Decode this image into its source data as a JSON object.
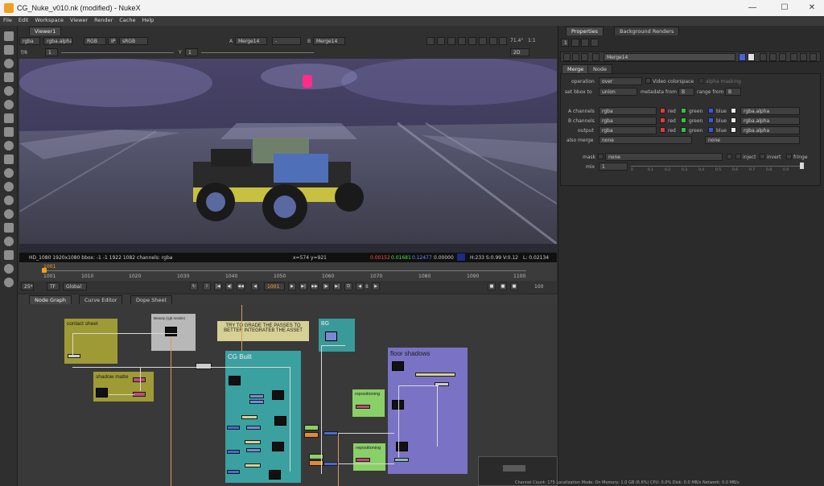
{
  "window": {
    "title": "CG_Nuke_v010.nk (modified) - NukeX"
  },
  "menu": [
    "File",
    "Edit",
    "Workspace",
    "Viewer",
    "Render",
    "Cache",
    "Help"
  ],
  "viewer": {
    "tab": "Viewer1",
    "channels": "rgba",
    "alpha": "rgba.alpha",
    "colorspace_mode": "RGB",
    "ip": "IP",
    "lut": "sRGB",
    "input_a_label": "A",
    "input_a": "Merge14",
    "input_sep": "-",
    "input_b_label": "B",
    "input_b": "Merge14",
    "zoom": "71.4°",
    "ratio": "1:1",
    "fstop": "f/8",
    "frame_field": "1",
    "y_label": "Y",
    "y_value": "1",
    "view_mode": "2D"
  },
  "infobar": {
    "format": "HD_1080 1920x1080  bbox: -1 -1 1922 1082 channels: rgba",
    "coords": "x=574 y=921",
    "r": "0.00152",
    "g": "0.01681",
    "b": "0.12477",
    "a": "0.00000",
    "hsv": "H:233 S:0.99 V:0.12",
    "l": "L: 0.02134"
  },
  "timeline": {
    "current_frame_marker": "1001",
    "ticks": [
      "1001",
      "1010",
      "1020",
      "1030",
      "1040",
      "1050",
      "1060",
      "1070",
      "1080",
      "1090",
      "1100"
    ],
    "fps": "25*",
    "tf": "TF",
    "scope": "Global",
    "frame": "1001",
    "step": "8",
    "end": "100"
  },
  "nodegraph": {
    "tabs": [
      "Node Graph",
      "Curve Editor",
      "Dope Sheet"
    ],
    "backdrops": {
      "contact_sheet": "contact sheet",
      "beauty": "Beauty (rgb render)",
      "note": "TRY TO GRADE THE PASSES TO BETTER INTEGRATEB THE ASSET",
      "bg": "BG",
      "cg_built": "CG Built",
      "floor_shadows": "floor shadows",
      "shadow_matte": "shadow matte",
      "repositioning_1": "repositioning",
      "repositioning_2": "repositioning"
    }
  },
  "properties": {
    "tabs": [
      "Properties",
      "Background Renders"
    ],
    "max_panels": "1",
    "node_name": "Merge14",
    "subtabs": [
      "Merge",
      "Node"
    ],
    "operation_label": "operation",
    "operation": "over",
    "video_colorspace": "Video colorspace",
    "alpha_masking": "alpha masking",
    "set_bbox_label": "set bbox to",
    "set_bbox": "union",
    "metadata_from_label": "metadata from",
    "metadata_from": "B",
    "range_from_label": "range from",
    "range_from": "B",
    "a_channels_label": "A channels",
    "b_channels_label": "B channels",
    "output_label": "output",
    "also_merge_label": "also merge",
    "channel_value": "rgba",
    "alpha_value": "rgba.alpha",
    "none": "none",
    "red": "red",
    "green": "green",
    "blue": "blue",
    "mask_label": "mask",
    "inject": "inject",
    "invert": "invert",
    "fringe": "fringe",
    "mix_label": "mix",
    "mix": "1",
    "mix_ticks": [
      "0",
      "0.1",
      "0.2",
      "0.3",
      "0.4",
      "0.5",
      "0.6",
      "0.7",
      "0.8",
      "0.9"
    ]
  },
  "statusbar": {
    "text": "Channel Count: 175  Localization Mode: On  Memory: 1.0 GB (6.6%)  CPU: 0.0%  Disk: 0.0 MB/s  Network: 0.0 MB/s"
  }
}
